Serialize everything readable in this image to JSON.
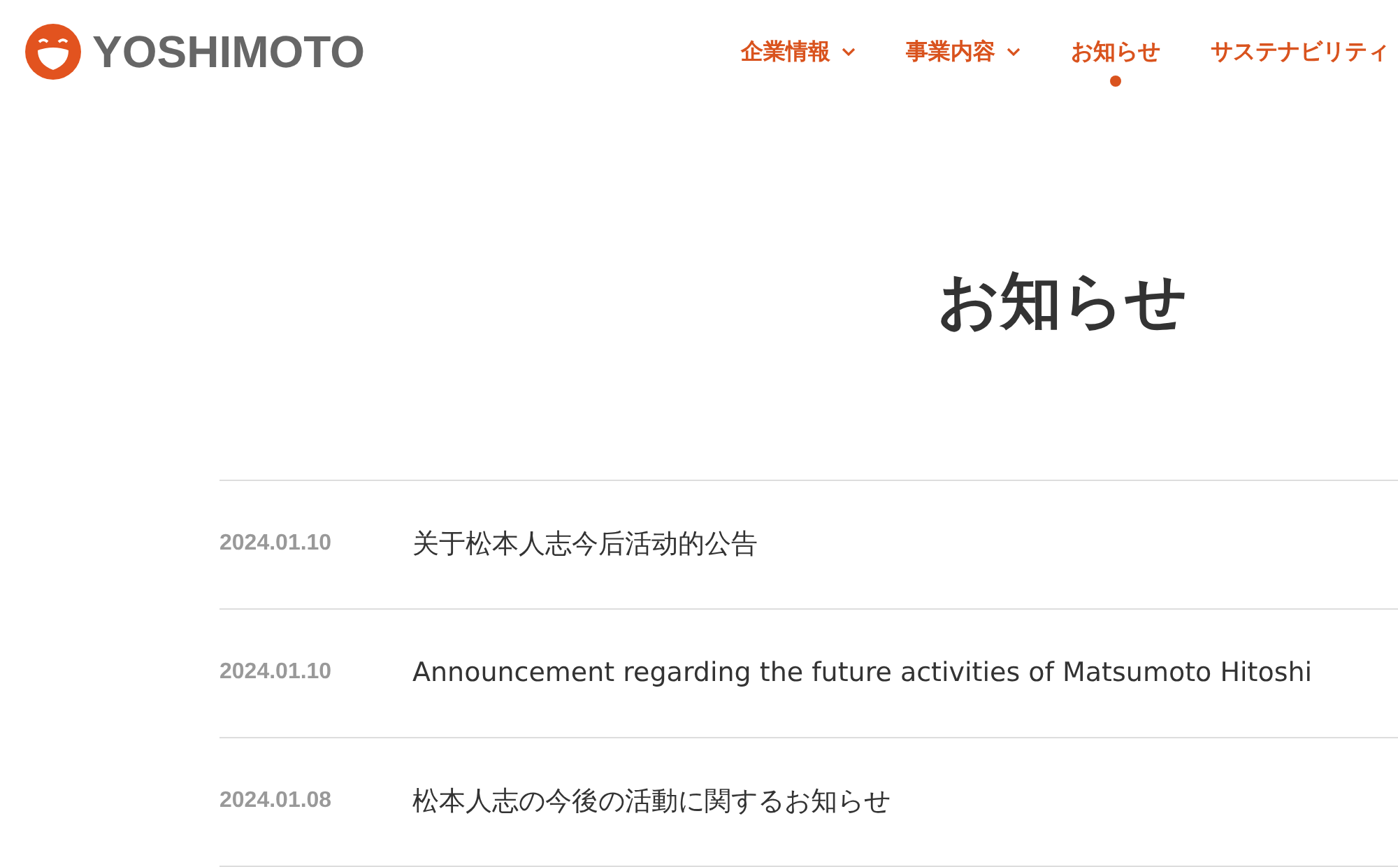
{
  "logo": {
    "text": "YOSHIMOTO"
  },
  "nav": [
    {
      "label": "企業情報",
      "dropdown": true,
      "selected": false
    },
    {
      "label": "事業内容",
      "dropdown": true,
      "selected": false
    },
    {
      "label": "お知らせ",
      "dropdown": false,
      "selected": true
    },
    {
      "label": "サステナビリティ",
      "dropdown": false,
      "selected": false
    }
  ],
  "title": "お知らせ",
  "news": [
    {
      "date": "2024.01.10",
      "text": "关于松本人志今后活动的公告"
    },
    {
      "date": "2024.01.10",
      "text": "Announcement regarding the future activities of Matsumoto Hitoshi"
    },
    {
      "date": "2024.01.08",
      "text": "松本人志の今後の活動に関するお知らせ"
    }
  ]
}
